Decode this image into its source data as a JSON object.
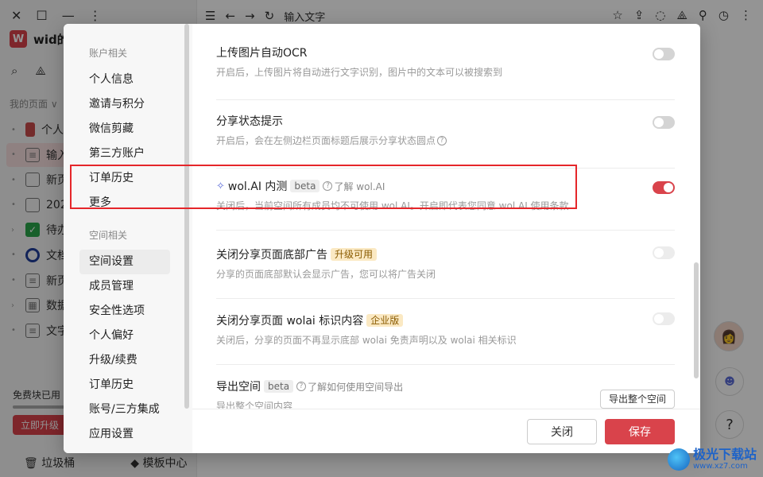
{
  "app": {
    "workspace_logo": "W",
    "workspace_name": "wid的",
    "my_pages_label": "我的页面 ∨",
    "page_items": [
      "个人",
      "输入",
      "新页",
      "202",
      "待办",
      "文档",
      "新页",
      "数据",
      "文字"
    ],
    "free_block_label": "免费块已用",
    "upgrade_button": "立即升级",
    "trash_label": "垃圾桶",
    "template_center_label": "模板中心",
    "page_title": "输入文字",
    "avatar_emoji": "👩",
    "help_symbol": "?"
  },
  "modal": {
    "nav": {
      "account_section": "账户相关",
      "account_items": [
        "个人信息",
        "邀请与积分",
        "微信剪藏",
        "第三方账户",
        "订单历史",
        "更多"
      ],
      "space_section": "空间相关",
      "space_items": [
        "空间设置",
        "成员管理",
        "安全性选项",
        "个人偏好",
        "升级/续费",
        "订单历史",
        "账号/三方集成",
        "应用设置"
      ]
    },
    "settings": {
      "ocr_title": "上传图片自动OCR",
      "ocr_desc": "开启后，上传图片将自动进行文字识别，图片中的文本可以被搜索到",
      "share_status_title": "分享状态提示",
      "share_status_desc": "开启后，会在左侧边栏页面标题后展示分享状态圆点",
      "ai_title": "wol.AI 内测",
      "ai_tag": "beta",
      "ai_link": "了解 wol.AI",
      "ai_desc": "关闭后，当前空间所有成员均不可使用 wol.AI。开启即代表您同意 wol.AI 使用条款",
      "ads_title": "关闭分享页面底部广告",
      "ads_tag": "升级可用",
      "ads_desc": "分享的页面底部默认会显示广告，您可以将广告关闭",
      "brand_title": "关闭分享页面 wolai 标识内容",
      "brand_tag": "企业版",
      "brand_desc": "关闭后，分享的页面不再显示底部 wolai 免责声明以及 wolai 相关标识",
      "export_title": "导出空间",
      "export_tag": "beta",
      "export_link": "了解如何使用空间导出",
      "export_desc": "导出整个空间内容",
      "export_button": "导出整个空间"
    },
    "footer": {
      "close_label": "关闭",
      "save_label": "保存"
    }
  },
  "watermark": {
    "main": "极光下载站",
    "sub": "www.xz7.com"
  },
  "colors": {
    "accent": "#d9434b",
    "highlight_border": "#e5262a",
    "ai_accent": "#5a6bd8"
  },
  "icons": [
    "close-icon",
    "maximize-icon",
    "minimize-icon",
    "more-icon",
    "search-icon",
    "graph-icon",
    "menu-icon",
    "back-icon",
    "forward-icon",
    "refresh-icon",
    "star-icon",
    "share-icon",
    "comment-icon",
    "user-add-icon",
    "history-icon",
    "more-vertical-icon",
    "sparkle-icon",
    "question-icon",
    "trash-icon",
    "template-icon",
    "bot-icon"
  ]
}
